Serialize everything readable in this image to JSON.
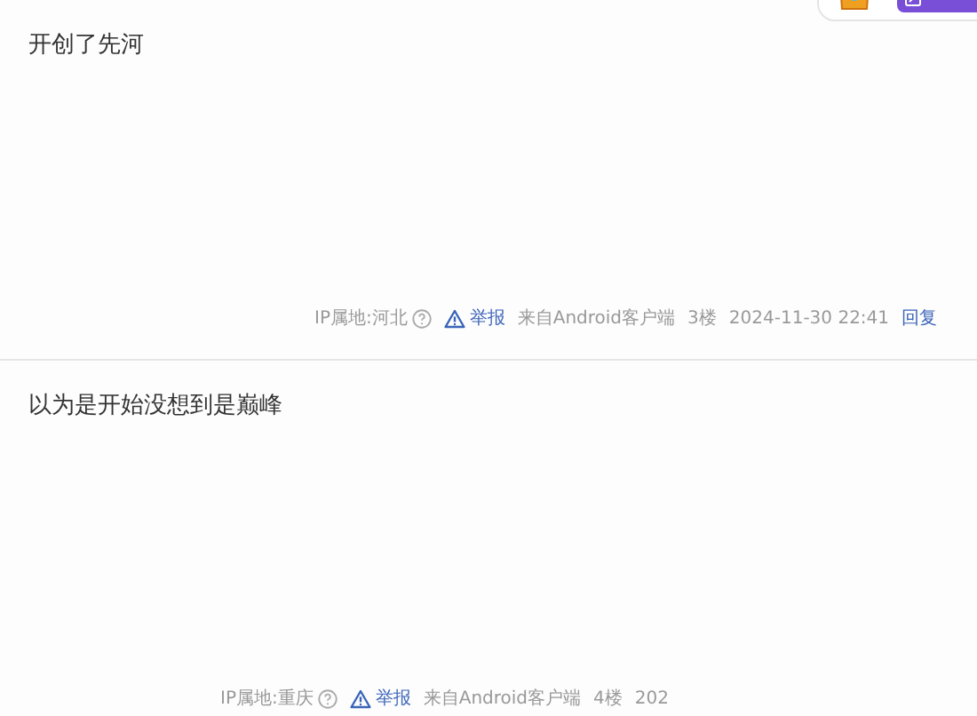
{
  "posts": [
    {
      "content": "开创了先河",
      "footer": {
        "ip": "IP属地:河北",
        "report": "举报",
        "source": "来自Android客户端",
        "floor": "3楼",
        "time": "2024-11-30 22:41",
        "reply": "回复"
      }
    },
    {
      "content": "以为是开始没想到是巅峰",
      "footer": {
        "ip": "IP属地:重庆",
        "report": "举报",
        "source": "来自Android客户端",
        "floor": "4楼",
        "time": "202"
      }
    }
  ]
}
